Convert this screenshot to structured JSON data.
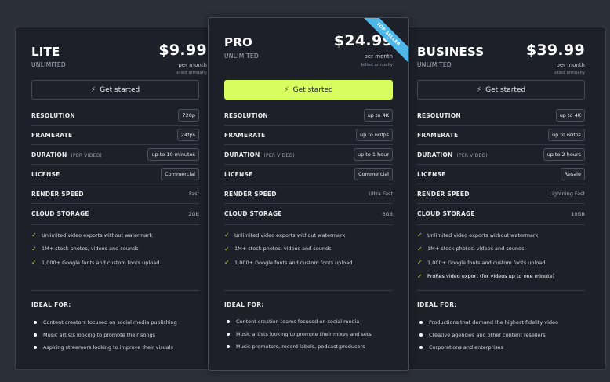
{
  "plans": [
    {
      "name": "LITE",
      "subtitle": "UNLIMITED",
      "price": "$9.99",
      "per": "per month",
      "billed": "billed annually",
      "cta": "Get started",
      "features": [
        {
          "label": "RESOLUTION",
          "note": "",
          "value": "720p",
          "style": "pill"
        },
        {
          "label": "FRAMERATE",
          "note": "",
          "value": "24fps",
          "style": "pill"
        },
        {
          "label": "DURATION",
          "note": "(PER VIDEO)",
          "value": "up to 10 minutes",
          "style": "pill"
        },
        {
          "label": "LICENSE",
          "note": "",
          "value": "Commercial",
          "style": "pill"
        },
        {
          "label": "RENDER SPEED",
          "note": "",
          "value": "Fast",
          "style": "plain"
        },
        {
          "label": "CLOUD STORAGE",
          "note": "",
          "value": "2GB",
          "style": "plain"
        }
      ],
      "checks": [
        "Unlimited video exports without watermark",
        "1M+ stock photos, videos and sounds",
        "1,000+ Google fonts and custom fonts upload"
      ],
      "ideal_title": "IDEAL FOR:",
      "ideal": [
        "Content creators focused on social media publishing",
        "Music artists looking to promote their songs",
        "Aspiring streamers looking to improve their visuals"
      ]
    },
    {
      "name": "PRO",
      "subtitle": "UNLIMITED",
      "price": "$24.99",
      "per": "per month",
      "billed": "billed annually",
      "cta": "Get started",
      "badge": "TOP SELLER",
      "features": [
        {
          "label": "RESOLUTION",
          "note": "",
          "value": "up to 4K",
          "style": "pill"
        },
        {
          "label": "FRAMERATE",
          "note": "",
          "value": "up to 60fps",
          "style": "pill"
        },
        {
          "label": "DURATION",
          "note": "(PER VIDEO)",
          "value": "up to 1 hour",
          "style": "pill"
        },
        {
          "label": "LICENSE",
          "note": "",
          "value": "Commercial",
          "style": "pill"
        },
        {
          "label": "RENDER SPEED",
          "note": "",
          "value": "Ultra Fast",
          "style": "plain"
        },
        {
          "label": "CLOUD STORAGE",
          "note": "",
          "value": "6GB",
          "style": "plain"
        }
      ],
      "checks": [
        "Unlimited video exports without watermark",
        "1M+ stock photos, videos and sounds",
        "1,000+ Google fonts and custom fonts upload"
      ],
      "ideal_title": "IDEAL FOR:",
      "ideal": [
        "Content creation teams focused on social media",
        "Music artists looking to promote their mixes and sets",
        "Music promoters, record labels, podcast producers"
      ]
    },
    {
      "name": "BUSINESS",
      "subtitle": "UNLIMITED",
      "price": "$39.99",
      "per": "per month",
      "billed": "billed annually",
      "cta": "Get started",
      "features": [
        {
          "label": "RESOLUTION",
          "note": "",
          "value": "up to 4K",
          "style": "pill"
        },
        {
          "label": "FRAMERATE",
          "note": "",
          "value": "up to 60fps",
          "style": "pill"
        },
        {
          "label": "DURATION",
          "note": "(PER VIDEO)",
          "value": "up to 2 hours",
          "style": "pill"
        },
        {
          "label": "LICENSE",
          "note": "",
          "value": "Resale",
          "style": "pill"
        },
        {
          "label": "RENDER SPEED",
          "note": "",
          "value": "Lightning Fast",
          "style": "plain"
        },
        {
          "label": "CLOUD STORAGE",
          "note": "",
          "value": "10GB",
          "style": "plain"
        }
      ],
      "checks": [
        "Unlimited video exports without watermark",
        "1M+ stock photos, videos and sounds",
        "1,000+ Google fonts and custom fonts upload",
        "ProRes video export (for videos up to one minute)"
      ],
      "ideal_title": "IDEAL FOR:",
      "ideal": [
        "Productions that demand the highest fidelity video",
        "Creative agencies and other content resellers",
        "Corporations and enterprises"
      ]
    }
  ],
  "icons": {
    "bolt": "bolt-icon",
    "check": "check-icon",
    "bullet": "bullet-icon"
  },
  "colors": {
    "accent": "#d8fd5e",
    "badge": "#4fb6e8",
    "check": "#b6e036",
    "card_bg": "#1d2029",
    "page_bg": "#2b2f38"
  }
}
